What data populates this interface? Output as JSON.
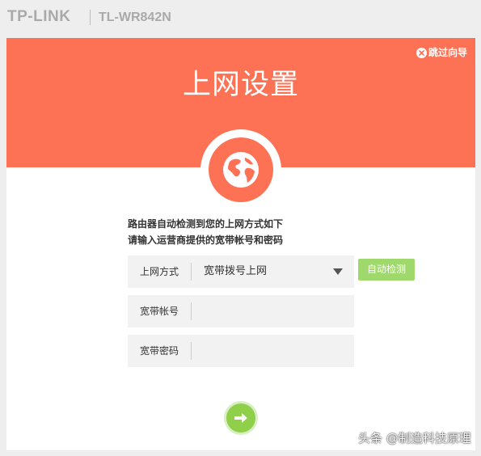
{
  "header": {
    "brand": "TP-LINK",
    "model": "TL-WR842N"
  },
  "hero": {
    "skip_label": "跳过向导",
    "title": "上网设置",
    "skip_icon": "close-circle-icon",
    "center_icon": "globe-icon"
  },
  "intro": {
    "line1": "路由器自动检测到您的上网方式如下",
    "line2": "请输入运营商提供的宽带帐号和密码"
  },
  "form": {
    "connection_type_label": "上网方式",
    "connection_type_value": "宽带拨号上网",
    "auto_detect_label": "自动检测",
    "account_label": "宽带帐号",
    "account_value": "",
    "password_label": "宽带密码",
    "password_value": ""
  },
  "footer": {
    "next_icon": "arrow-right-icon",
    "watermark": "头条 @制造科技原理"
  },
  "colors": {
    "hero": "#fd7154",
    "accent_green": "#9fd86b",
    "next_green": "#8fcf4a",
    "page_bg": "#eeeeee"
  }
}
